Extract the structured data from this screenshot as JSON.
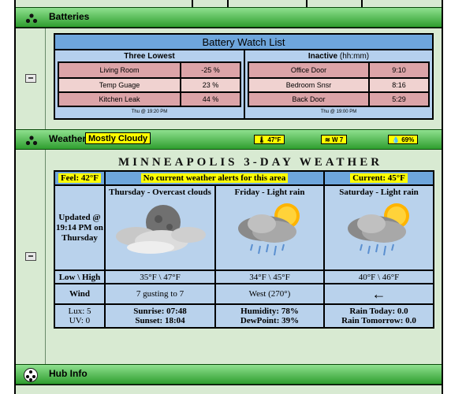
{
  "batteries_bar": {
    "title": "Batteries"
  },
  "battery_watch": {
    "title": "Battery Watch List",
    "lowest": {
      "heading": "Three Lowest",
      "rows": [
        {
          "name": "Living Room",
          "value": "-25 %"
        },
        {
          "name": "Temp Guage",
          "value": "23 %"
        },
        {
          "name": "Kitchen Leak",
          "value": "44 %"
        }
      ],
      "footer": "Thu @ 19:20 PM"
    },
    "inactive": {
      "heading": "Inactive",
      "subheading": "(hh:mm)",
      "rows": [
        {
          "name": "Office Door",
          "value": "9:10"
        },
        {
          "name": "Bedroom Snsr",
          "value": "8:16"
        },
        {
          "name": "Back Door",
          "value": "5:29"
        }
      ],
      "footer": "Thu @ 19:00 PM"
    }
  },
  "weather_bar": {
    "title": "Weather",
    "condition": "Mostly Cloudy",
    "temp": "🌡 47°F",
    "wind": "W 7",
    "humidity": "69%"
  },
  "forecast": {
    "title": "MINNEAPOLIS 3-DAY WEATHER",
    "feel": "Feel: 42°F",
    "alerts": "No current weather alerts for this area",
    "current": "Current: 45°F",
    "updated": "Updated @ 19:14 PM on Thursday",
    "days": [
      {
        "name": "Thursday - Overcast clouds",
        "lowhigh": "35°F \\ 47°F",
        "wind": "7 gusting to 7"
      },
      {
        "name": "Friday - Light rain",
        "lowhigh": "34°F \\ 45°F",
        "wind": "West (270°)"
      },
      {
        "name": "Saturday - Light rain",
        "lowhigh": "40°F \\ 46°F",
        "wind": "←"
      }
    ],
    "labels": {
      "lowhigh": "Low \\ High",
      "wind": "Wind"
    },
    "lux": "Lux: 5",
    "uv": "UV: 0",
    "sunrise": "Sunrise: 07:48",
    "sunset": "Sunset: 18:04",
    "humidity": "Humidity: 78%",
    "dewpoint": "DewPoint: 39%",
    "rain_today": "Rain Today: 0.0",
    "rain_tomorrow": "Rain Tomorrow: 0.0"
  },
  "hub_bar": {
    "title": "Hub Info"
  },
  "icons": [
    "tile-group-icon",
    "collapse-icon",
    "thermometer-icon",
    "wind-icon",
    "humidity-icon",
    "cloud-moon-icon",
    "rain-sun-icon",
    "hub-icon"
  ]
}
